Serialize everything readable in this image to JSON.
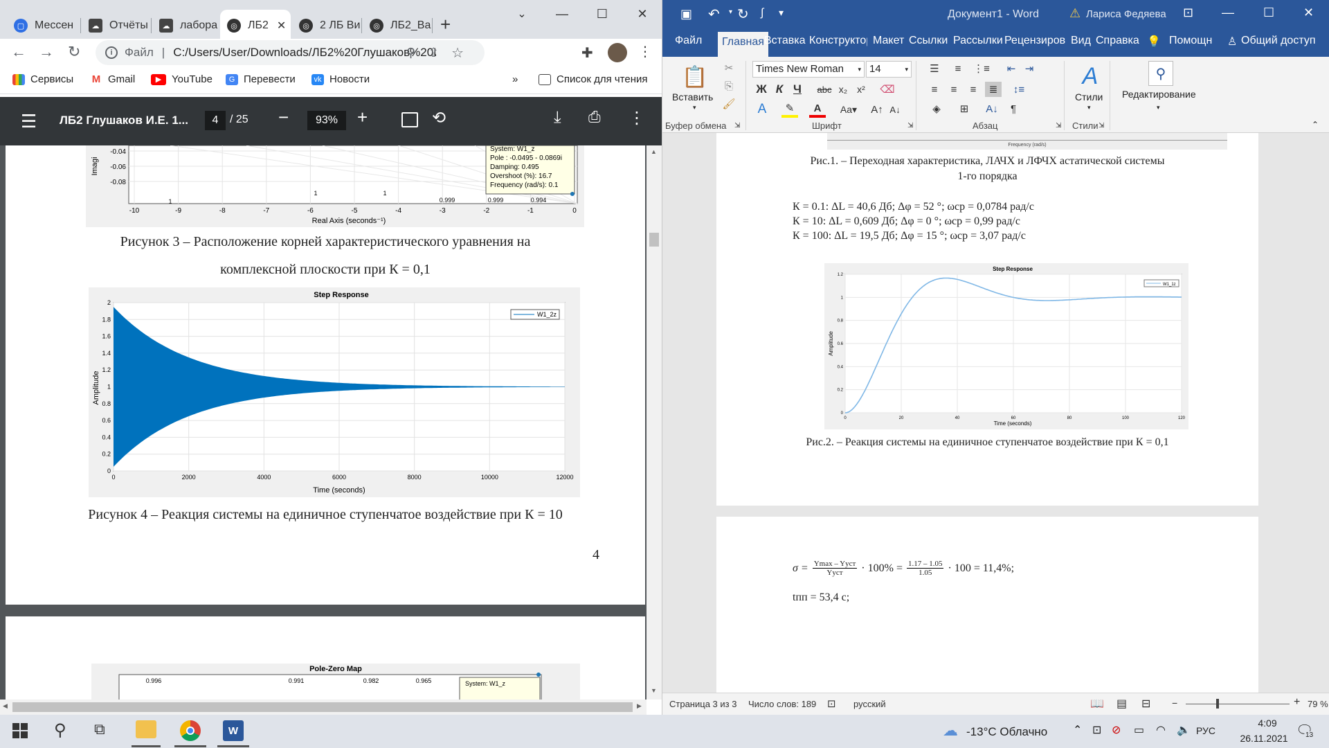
{
  "chrome": {
    "tabs": [
      {
        "label": "Мессен",
        "icon": "messenger-icon"
      },
      {
        "label": "Отчёты",
        "icon": "cloud-icon"
      },
      {
        "label": "лабора",
        "icon": "cloud-icon"
      },
      {
        "label": "ЛБ2",
        "icon": "globe-icon"
      },
      {
        "label": "2 ЛБ Ви",
        "icon": "globe-icon"
      },
      {
        "label": "ЛБ2_Ва",
        "icon": "globe-icon"
      }
    ],
    "address": {
      "scheme": "Файл",
      "url": "C:/Users/User/Downloads/ЛБ2%20Глушаков%20И.Е.%2..."
    },
    "bookmarks": [
      "Сервисы",
      "Gmail",
      "YouTube",
      "Перевести",
      "Новости"
    ],
    "reading_list": "Список для чтения",
    "pdf": {
      "title": "ЛБ2 Глушаков И.Е. 1...",
      "page": "4",
      "total": "/ 25",
      "zoom": "93%"
    }
  },
  "pdf_content": {
    "fig3_caption_line1": "Рисунок 3 – Расположение корней характеристического уравнения на",
    "fig3_caption_line2": "комплексной плоскости при К = 0,1",
    "fig4_caption": "Рисунок 4 – Реакция системы на единичное ступенчатое воздействие при К = 10",
    "page_number": "4",
    "next_chart_title": "Pole-Zero Map",
    "next_chart_system": "System: W1_z"
  },
  "chart_data": [
    {
      "type": "scatter",
      "title": "",
      "xlabel": "Real Axis (seconds⁻¹)",
      "ylabel": "Imagi",
      "x_ticks": [
        "-10",
        "-9",
        "-8",
        "-7",
        "-6",
        "-5",
        "-4",
        "-3",
        "-2",
        "-1",
        "0"
      ],
      "y_ticks": [
        "-0.04",
        "-0.06",
        "-0.08"
      ],
      "damping_labels": [
        "1",
        "1",
        "1",
        "0.999",
        "0.999",
        "0.994"
      ],
      "tooltip": {
        "system": "System: W1_z",
        "pole": "Pole : -0.0495 - 0.0869i",
        "damping": "Damping: 0.495",
        "overshoot": "Overshoot (%): 16.7",
        "frequency": "Frequency (rad/s): 0.1"
      },
      "points": [
        {
          "x": -0.0495,
          "y": -0.0869
        }
      ]
    },
    {
      "type": "line",
      "title": "Step Response",
      "xlabel": "Time (seconds)",
      "ylabel": "Amplitude",
      "legend": "W1_2z",
      "x_ticks": [
        "0",
        "2000",
        "4000",
        "6000",
        "8000",
        "10000",
        "12000"
      ],
      "y_ticks": [
        "0",
        "0.2",
        "0.4",
        "0.6",
        "0.8",
        "1",
        "1.2",
        "1.4",
        "1.6",
        "1.8",
        "2"
      ],
      "xlim": [
        0,
        12000
      ],
      "ylim": [
        0,
        2
      ],
      "envelope": {
        "start_upper": 1.95,
        "start_lower": 0.05,
        "final": 1,
        "decay_time_constant": 2000
      }
    },
    {
      "type": "line",
      "title": "Step Response",
      "xlabel": "Time (seconds)",
      "ylabel": "Amplitude",
      "legend": "W1_1z",
      "x_ticks": [
        "0",
        "20",
        "40",
        "60",
        "80",
        "100",
        "120"
      ],
      "y_ticks": [
        "0",
        "0.2",
        "0.4",
        "0.6",
        "0.8",
        "1",
        "1.2"
      ],
      "xlim": [
        0,
        120
      ],
      "ylim": [
        0,
        1.2
      ],
      "peak": {
        "x": 36,
        "y": 1.17
      },
      "final": 1
    }
  ],
  "word": {
    "title": "Документ1 - Word",
    "user": "Лариса Федяева",
    "tabs": [
      "Файл",
      "Главная",
      "Вставка",
      "Конструктор",
      "Макет",
      "Ссылки",
      "Рассылки",
      "Рецензиров",
      "Вид",
      "Справка"
    ],
    "help": "Помощн",
    "share": "Общий доступ",
    "font_name": "Times New Roman",
    "font_size": "14",
    "groups": [
      "Буфер обмена",
      "Шрифт",
      "Абзац",
      "Стили"
    ],
    "paste": "Вставить",
    "styles": "Стили",
    "editing": "Редактирование",
    "freq_label": "Frequency (rad/s)",
    "fig1_caption_line1": "Рис.1. – Переходная характеристика, ЛАЧХ и ЛФЧХ астатической системы",
    "fig1_caption_line2": "1-го порядка",
    "k_lines": [
      "К = 0.1: ΔL = 40,6 Дб; Δφ = 52 °; ωср = 0,0784 рад/с",
      "К = 10: ΔL = 0,609 Дб; Δφ = 0 °; ωср = 0,99 рад/с",
      "К = 100: ΔL = 19,5 Дб; Δφ = 15 °; ωср = 3,07 рад/с"
    ],
    "fig2_caption": "Рис.2. – Реакция системы на единичное ступенчатое воздействие при К = 0,1",
    "formula": {
      "lhs": "σ =",
      "num1": "Ymax – Yуст",
      "den1": "Yуст",
      "mid": "· 100% =",
      "num2": "1.17 – 1.05",
      "den2": "1.05",
      "end": "· 100 = 11,4%;"
    },
    "tpp": "tпп = 53,4 с;",
    "status": {
      "page": "Страница 3 из 3",
      "words": "Число слов: 189",
      "lang": "русский",
      "zoom": "79 %"
    }
  },
  "taskbar": {
    "weather": "-13°C Облачно",
    "lang": "РУС",
    "time": "4:09",
    "date": "26.11.2021",
    "notifications": "13"
  }
}
